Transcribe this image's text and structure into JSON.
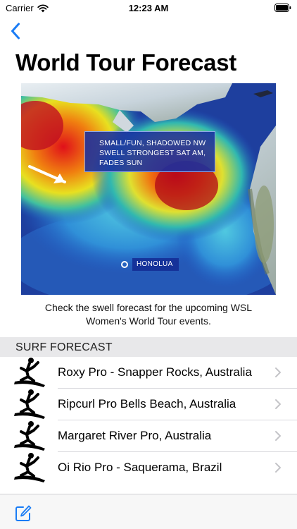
{
  "status": {
    "carrier": "Carrier",
    "time": "12:23 AM"
  },
  "nav": {
    "back_icon": "chevron-left-icon"
  },
  "page": {
    "title": "World Tour Forecast"
  },
  "map": {
    "callout_line1": "SMALL/FUN, SHADOWED NW",
    "callout_line2": "SWELL STRONGEST SAT AM,",
    "callout_line3": "FADES SUN",
    "location": "HONOLUA"
  },
  "caption": {
    "line1": "Check the swell forecast for the upcoming WSL",
    "line2": "Women's World Tour events."
  },
  "section": {
    "title": "SURF FORECAST"
  },
  "events": [
    {
      "label": "Roxy Pro - Snapper Rocks, Australia",
      "icon": "surfer-icon"
    },
    {
      "label": "Ripcurl Pro Bells Beach, Australia",
      "icon": "surfer-icon"
    },
    {
      "label": "Margaret River Pro, Australia",
      "icon": "surfer-icon"
    },
    {
      "label": "Oi Rio Pro - Saquerama, Brazil",
      "icon": "surfer-icon"
    }
  ],
  "toolbar": {
    "compose_icon": "compose-icon"
  },
  "colors": {
    "accent": "#1a7cf5",
    "section_bg": "#e8e8ea",
    "callout_bg": "#1830a0"
  }
}
